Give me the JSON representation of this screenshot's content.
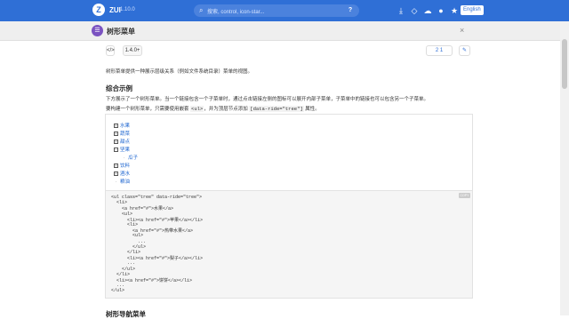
{
  "topbar": {
    "logo_letter": "Z",
    "brand": "ZUI",
    "version": "1.10.0",
    "search_placeholder": "搜索, control, icon-star...",
    "search_help": "?",
    "icons": [
      "download-icon",
      "diamond-icon",
      "chat-icon",
      "github-icon",
      "star-icon"
    ],
    "lang": "English"
  },
  "header": {
    "title": "树形菜单",
    "close": "×"
  },
  "meta": {
    "version_tag": "1.4.0+",
    "stats": "2  1"
  },
  "intro": "树形菜单提供一种展示层级关系（例如文件系统目录）菜单的视图。",
  "section1": {
    "title": "综合示例",
    "p1": "下方展示了一个树形菜单。当一个链接包含一个子菜单时，通过点击链接左侧的图标可以展开内部子菜单，子菜单中的链接也可以包含另一个子菜单。",
    "p2_pre": "要构建一个树形菜单，只需要使用嵌套 ",
    "p2_code1": "<ul>",
    "p2_mid": "，并为顶层节点添加 ",
    "p2_code2": "[data-ride=\"tree\"]",
    "p2_post": " 属性。"
  },
  "tree": {
    "items": [
      {
        "label": "水果",
        "type": "box"
      },
      {
        "label": "蔬菜",
        "type": "box"
      },
      {
        "label": "甜点",
        "type": "box"
      },
      {
        "label": "坚果",
        "type": "box-open"
      },
      {
        "label": "瓜子",
        "type": "child"
      },
      {
        "label": "饮料",
        "type": "box"
      },
      {
        "label": "酒水",
        "type": "box"
      },
      {
        "label": "粮油",
        "type": "leaf"
      }
    ]
  },
  "code": {
    "copy": "COPY",
    "lines": [
      "<ul class=\"tree\" data-ride=\"tree\">",
      "  <li>",
      "    <a href=\"#\">水果</a>",
      "    <ul>",
      "      <li><a href=\"#\">苹果</a></li>",
      "      <li>",
      "        <a href=\"#\">热带水果</a>",
      "        <ul>",
      "          ...",
      "        </ul>",
      "      </li>",
      "      <li><a href=\"#\">梨子</a></li>",
      "      ...",
      "    </ul>",
      "  </li>",
      "  <li><a href=\"#\">饼饼</a></li>",
      "  ...",
      "</ul>"
    ]
  },
  "section2": {
    "title": "树形导航菜单"
  }
}
